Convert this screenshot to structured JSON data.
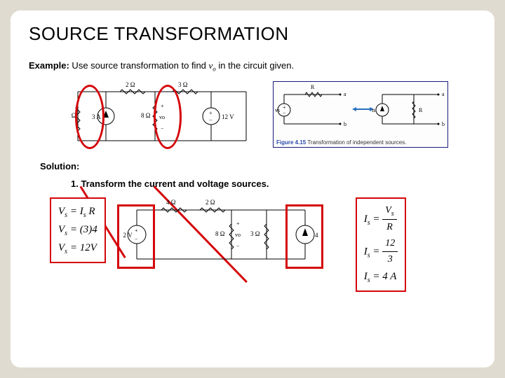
{
  "title": "SOURCE TRANSFORMATION",
  "example_prefix": "Example:",
  "example_text1": " Use source transformation to find ",
  "example_var": "v",
  "example_var_sub": "o",
  "example_text2": " in the circuit given.",
  "circuit1": {
    "r_left": "4 Ω",
    "i_src": "3 A",
    "r_top1": "2 Ω",
    "r_top2": "3 Ω",
    "r_mid": "8 Ω",
    "v_mid": "vo",
    "v_right": "12 V"
  },
  "ref": {
    "R1": "R",
    "vs": "vs",
    "is": "is",
    "R2": "R",
    "alabel": "a",
    "blabel": "b",
    "caption_num": "Figure 4.15",
    "caption_txt": "  Transformation of independent sources."
  },
  "solution_label": "Solution:",
  "step1": "1.  Transform the current and voltage sources.",
  "eq_left": {
    "l1a": "V",
    "l1b": "s",
    "l1c": " = I",
    "l1d": "s",
    "l1e": " R",
    "l2": "Vs = (3)4",
    "l3": "Vs = 12V"
  },
  "circuit2": {
    "r_top1": "4 Ω",
    "r_top2": "2 Ω",
    "v_left": "12 V",
    "r_mid": "8 Ω",
    "v_node": "vo",
    "r_right": "3 Ω",
    "i_right": "4 A"
  },
  "eq_right": {
    "lhs": "Is",
    "num1": "Vs",
    "den1": "R",
    "num2": "12",
    "den2": "3",
    "res": "Is = 4 A"
  }
}
